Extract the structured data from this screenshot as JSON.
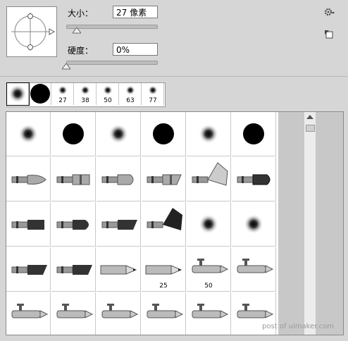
{
  "brush_settings": {
    "size_label": "大小：",
    "size_value": "27 像素",
    "size_slider_fraction": 0.12,
    "hardness_label": "硬度：",
    "hardness_value": "0%",
    "hardness_slider_fraction": 0.0
  },
  "presets": [
    {
      "type": "soft",
      "label": ""
    },
    {
      "type": "hard",
      "label": ""
    },
    {
      "type": "soft",
      "label": "27"
    },
    {
      "type": "soft",
      "label": "38"
    },
    {
      "type": "soft",
      "label": "50"
    },
    {
      "type": "soft",
      "label": "63"
    },
    {
      "type": "soft",
      "label": "77"
    }
  ],
  "brush_grid": [
    [
      {
        "kind": "soft",
        "label": ""
      },
      {
        "kind": "hard",
        "label": ""
      },
      {
        "kind": "soft",
        "label": ""
      },
      {
        "kind": "hard",
        "label": ""
      },
      {
        "kind": "soft",
        "label": ""
      },
      {
        "kind": "hard",
        "label": ""
      }
    ],
    [
      {
        "kind": "round-tip",
        "label": ""
      },
      {
        "kind": "flat",
        "label": ""
      },
      {
        "kind": "round",
        "label": ""
      },
      {
        "kind": "angle",
        "label": ""
      },
      {
        "kind": "fan",
        "label": ""
      },
      {
        "kind": "dark-flat",
        "label": ""
      }
    ],
    [
      {
        "kind": "bristle-flat",
        "label": ""
      },
      {
        "kind": "bristle-round",
        "label": ""
      },
      {
        "kind": "bristle-angle",
        "label": ""
      },
      {
        "kind": "bristle-fan",
        "label": ""
      },
      {
        "kind": "soft",
        "label": ""
      },
      {
        "kind": "soft",
        "label": ""
      }
    ],
    [
      {
        "kind": "bristle-angle",
        "label": ""
      },
      {
        "kind": "bristle-angle",
        "label": ""
      },
      {
        "kind": "pencil",
        "label": ""
      },
      {
        "kind": "pencil",
        "label": "25"
      },
      {
        "kind": "airbrush",
        "label": "50"
      },
      {
        "kind": "airbrush",
        "label": ""
      }
    ],
    [
      {
        "kind": "airbrush",
        "label": ""
      },
      {
        "kind": "airbrush",
        "label": ""
      },
      {
        "kind": "airbrush",
        "label": ""
      },
      {
        "kind": "airbrush",
        "label": ""
      },
      {
        "kind": "airbrush",
        "label": ""
      },
      {
        "kind": "airbrush",
        "label": ""
      }
    ]
  ],
  "watermark": "post of uimaker.com",
  "icons": [
    "gear-icon",
    "new-preset-icon"
  ]
}
